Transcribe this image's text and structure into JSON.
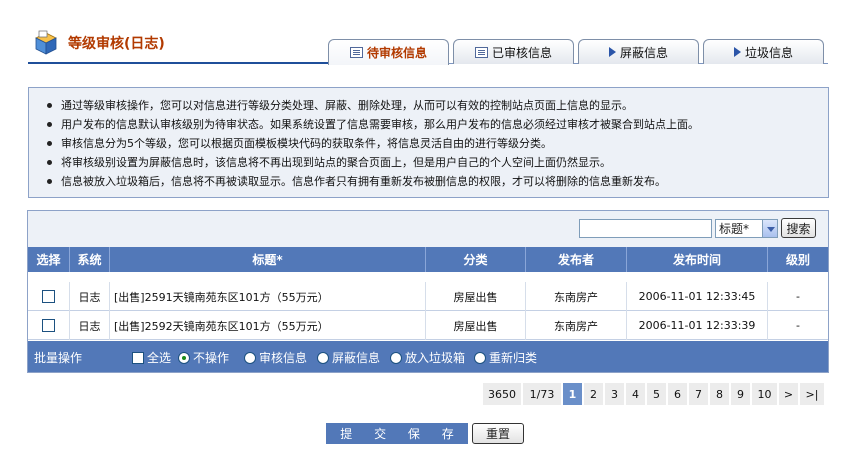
{
  "header": {
    "title": "等级审核(日志)"
  },
  "tabs": [
    {
      "label": "待审核信息",
      "icon": "document-icon",
      "active": true
    },
    {
      "label": "已审核信息",
      "icon": "document-icon",
      "active": false
    },
    {
      "label": "屏蔽信息",
      "icon": "arrow-right-icon",
      "active": false
    },
    {
      "label": "垃圾信息",
      "icon": "arrow-right-icon",
      "active": false
    }
  ],
  "info": [
    "通过等级审核操作，您可以对信息进行等级分类处理、屏蔽、删除处理，从而可以有效的控制站点页面上信息的显示。",
    "用户发布的信息默认审核级别为待审状态。如果系统设置了信息需要审核，那么用户发布的信息必须经过审核才被聚合到站点上面。",
    "审核信息分为5个等级，您可以根据页面模板模块代码的获取条件，将信息灵活自由的进行等级分类。",
    "将审核级别设置为屏蔽信息时，该信息将不再出现到站点的聚合页面上，但是用户自己的个人空间上面仍然显示。",
    "信息被放入垃圾箱后，信息将不再被读取显示。信息作者只有拥有重新发布被删信息的权限，才可以将删除的信息重新发布。"
  ],
  "search": {
    "value": "",
    "select_value": "标题*",
    "button": "搜索"
  },
  "table": {
    "columns": [
      "选择",
      "系统",
      "标题*",
      "分类",
      "发布者",
      "发布时间",
      "级别"
    ],
    "rows": [
      {
        "system": "日志",
        "title": "[出售]2591天镜南苑东区101方（55万元）",
        "category": "房屋出售",
        "publisher": "东南房产",
        "time": "2006-11-01 12:33:45",
        "level": "-"
      },
      {
        "system": "日志",
        "title": "[出售]2592天镜南苑东区101方（55万元）",
        "category": "房屋出售",
        "publisher": "东南房产",
        "time": "2006-11-01 12:33:39",
        "level": "-"
      }
    ]
  },
  "batch": {
    "label": "批量操作",
    "select_all": "全选",
    "options": [
      "不操作",
      "审核信息",
      "屏蔽信息",
      "放入垃圾箱",
      "重新归类"
    ],
    "selected": "不操作"
  },
  "pager": {
    "total": "3650",
    "page_of": "1/73",
    "pages": [
      "1",
      "2",
      "3",
      "4",
      "5",
      "6",
      "7",
      "8",
      "9",
      "10"
    ],
    "current": "1",
    "next": ">",
    "last": ">|"
  },
  "footer": {
    "submit": "提 交 保 存",
    "reset": "重置"
  },
  "colors": {
    "accent": "#5278b8",
    "title": "#b23a00",
    "panel_bg": "#edf1f7"
  }
}
